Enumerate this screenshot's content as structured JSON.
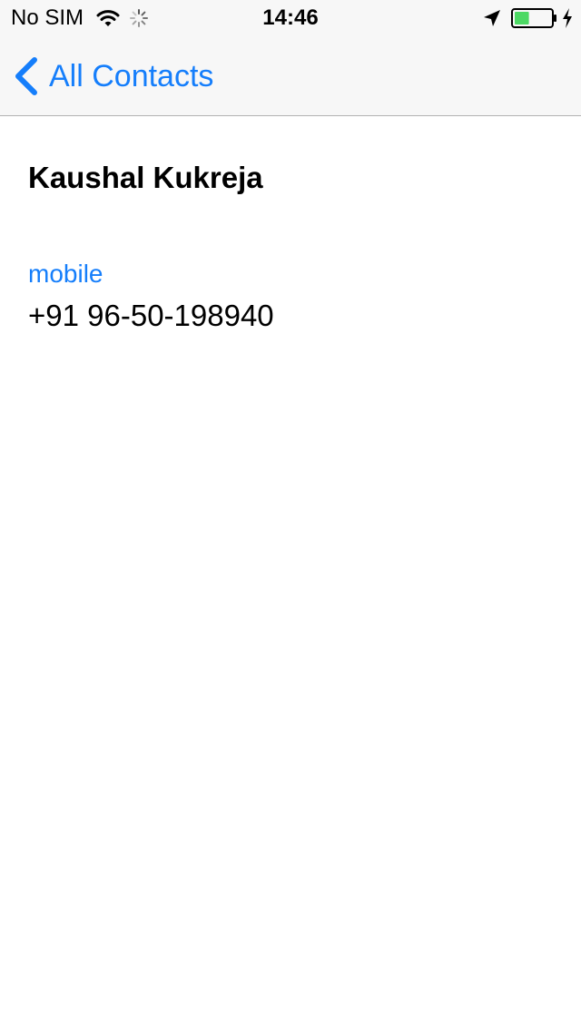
{
  "status_bar": {
    "carrier": "No SIM",
    "time": "14:46",
    "battery_level": 0.4,
    "icons": [
      "wifi-icon",
      "activity-spinner-icon",
      "location-arrow-icon",
      "battery-icon",
      "charging-bolt-icon"
    ]
  },
  "nav": {
    "back_label": "All Contacts",
    "back_icon": "chevron-left-icon"
  },
  "contact": {
    "name": "Kaushal Kukreja",
    "phone_label": "mobile",
    "phone_number": "+91 96-50-198940"
  },
  "colors": {
    "accent": "#157efb",
    "nav_background": "#f7f7f7",
    "battery_fill": "#4cd964"
  }
}
